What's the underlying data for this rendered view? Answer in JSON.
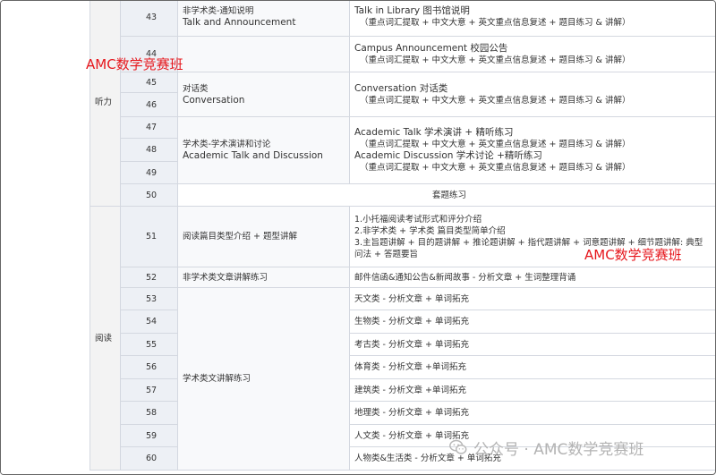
{
  "sections": {
    "listening": "听力",
    "reading": "阅读"
  },
  "rows": [
    {
      "num": "43",
      "topic": [
        "非学术类-通知说明",
        "Talk and Announcement"
      ],
      "content": [
        "Talk in Library 图书馆说明",
        "（重点词汇提取 + 中文大意 + 英文重点信息复述 + 题目练习 & 讲解）"
      ]
    },
    {
      "num": "44",
      "content": [
        "Campus Announcement 校园公告",
        "（重点词汇提取 + 中文大意 + 英文重点信息复述 + 题目练习 & 讲解）"
      ]
    },
    {
      "num": "45",
      "topic": [
        "对话类",
        "Conversation"
      ],
      "content": [
        "Conversation 对话类",
        "（重点词汇提取 + 中文大意 + 英文重点信息复述 + 题目练习 & 讲解）"
      ]
    },
    {
      "num": "46"
    },
    {
      "num": "47",
      "topic": [
        "学术类-学术演讲和讨论",
        "Academic Talk and Discussion"
      ],
      "content": [
        "Academic Talk 学术演讲 + 精听练习",
        "（重点词汇提取 + 中文大意 + 英文重点信息复述 + 题目练习 & 讲解）",
        "Academic Discussion 学术讨论 +精听练习",
        "（重点词汇提取 + 中文大意 + 英文重点信息复述 + 题目练习 & 讲解）"
      ]
    },
    {
      "num": "48"
    },
    {
      "num": "49"
    },
    {
      "num": "50",
      "content_wide": "套题练习"
    },
    {
      "num": "51",
      "topic": [
        "阅读篇目类型介绍 + 题型讲解"
      ],
      "content": [
        "1.小托福阅读考试形式和评分介绍",
        "2.非学术类 + 学术类 篇目类型简单介绍",
        "3.主旨题讲解 + 目的题讲解 + 推论题讲解 + 指代题讲解 + 词意题讲解 + 细节题讲解: 典型",
        "问法 + 答题要旨"
      ]
    },
    {
      "num": "52",
      "topic": [
        "非学术类文章讲解练习"
      ],
      "content": [
        "邮件信函&通知公告&新闻故事 - 分析文章 + 生词整理背诵"
      ]
    },
    {
      "num": "53",
      "topic": [
        "学术类文讲解练习"
      ],
      "content": [
        "天文类 - 分析文章 + 单词拓充"
      ]
    },
    {
      "num": "54",
      "content": [
        "生物类 - 分析文章 + 单词拓充"
      ]
    },
    {
      "num": "55",
      "content": [
        "考古类 - 分析文章 + 单词拓充"
      ]
    },
    {
      "num": "56",
      "content": [
        "体育类 - 分析文章 +单词拓充"
      ]
    },
    {
      "num": "57",
      "content": [
        "建筑类 - 分析文章 +单词拓充"
      ]
    },
    {
      "num": "58",
      "content": [
        "地理类 - 分析文章 + 单词拓充"
      ]
    },
    {
      "num": "59",
      "content": [
        "人文类 - 分析文章 + 单词拓充"
      ]
    },
    {
      "num": "60",
      "content": [
        "人物类&生活类 - 分析文章 + 单词拓充"
      ]
    }
  ],
  "watermarks": {
    "red_top": "AMC数学竞赛班",
    "red_mid": "AMC数学竞赛班",
    "wechat_label": "公众号 · AMC数学竞赛班",
    "wechat_icon": "wechat-icon",
    "red_color": "#e6161c"
  }
}
